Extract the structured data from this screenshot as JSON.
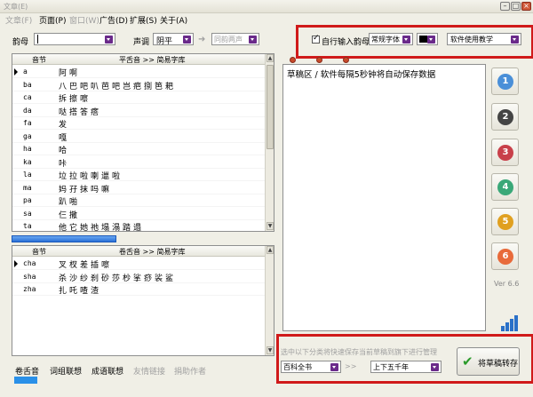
{
  "title": "文章(E)",
  "menu": [
    "文章(F)",
    "页面(P)",
    "窗口(W)",
    "广告(D)",
    "扩展(S)",
    "关于(A)"
  ],
  "toolbar": {
    "rhyme_label": "韵母",
    "rhyme_value": "",
    "tone_label": "声调",
    "tone_value": "阴平",
    "tone_arrow": "➜",
    "tone_target": "同韵两声",
    "auto_input_label": "自行输入韵母",
    "auto_input_checked": true,
    "font_value": "常规字体",
    "color_value": "#000000",
    "tutorial_value": "软件使用教学"
  },
  "top_grid": {
    "col1": "音节",
    "col2": "平舌音 >> 简易字库",
    "rows": [
      {
        "py": "a",
        "chars": "阿啊"
      },
      {
        "py": "ba",
        "chars": "八巴吧叭芭吧岂疤捌笆耙"
      },
      {
        "py": "ca",
        "chars": "拆擦嚓"
      },
      {
        "py": "da",
        "chars": "哒搭答瘩"
      },
      {
        "py": "fa",
        "chars": "发"
      },
      {
        "py": "ga",
        "chars": "嘎"
      },
      {
        "py": "ha",
        "chars": "哈"
      },
      {
        "py": "ka",
        "chars": "咔"
      },
      {
        "py": "la",
        "chars": "垃拉啦喇邋啦"
      },
      {
        "py": "ma",
        "chars": "妈孖抹吗嘛"
      },
      {
        "py": "pa",
        "chars": "趴啪"
      },
      {
        "py": "sa",
        "chars": "仨撒"
      },
      {
        "py": "ta",
        "chars": "他它她祂塌溻踏遢"
      }
    ]
  },
  "bottom_grid": {
    "col1": "音节",
    "col2": "卷舌音 >> 简易字库",
    "rows": [
      {
        "py": "cha",
        "chars": "叉杈差插嚓"
      },
      {
        "py": "sha",
        "chars": "杀沙纱刹砂莎杪挲痧裟鲨"
      },
      {
        "py": "zha",
        "chars": "扎吒喳渣"
      }
    ]
  },
  "draft": {
    "text": "草稿区 / 软件每隔5秒钟将自动保存数据"
  },
  "side_buttons": [
    {
      "num": "1",
      "color": "#4a8fd8"
    },
    {
      "num": "2",
      "color": "#444444"
    },
    {
      "num": "3",
      "color": "#c8404a"
    },
    {
      "num": "4",
      "color": "#3aa878"
    },
    {
      "num": "5",
      "color": "#e0a020"
    },
    {
      "num": "6",
      "color": "#e86a3a"
    }
  ],
  "version": "Ver 6.6",
  "save_panel": {
    "hint": "选中以下分类将快速保存当前草稿到旗下进行管理",
    "category": "百科全书",
    "arrow": ">>",
    "subcategory": "上下五千年",
    "save_label": "将草稿转存"
  },
  "bottom_tabs": [
    {
      "label": "卷舌音",
      "active": true
    },
    {
      "label": "词组联想",
      "active": false
    },
    {
      "label": "成语联想",
      "active": false
    },
    {
      "label": "友情链接",
      "active": false,
      "disabled": true
    },
    {
      "label": "捐助作者",
      "active": false,
      "disabled": true
    }
  ]
}
